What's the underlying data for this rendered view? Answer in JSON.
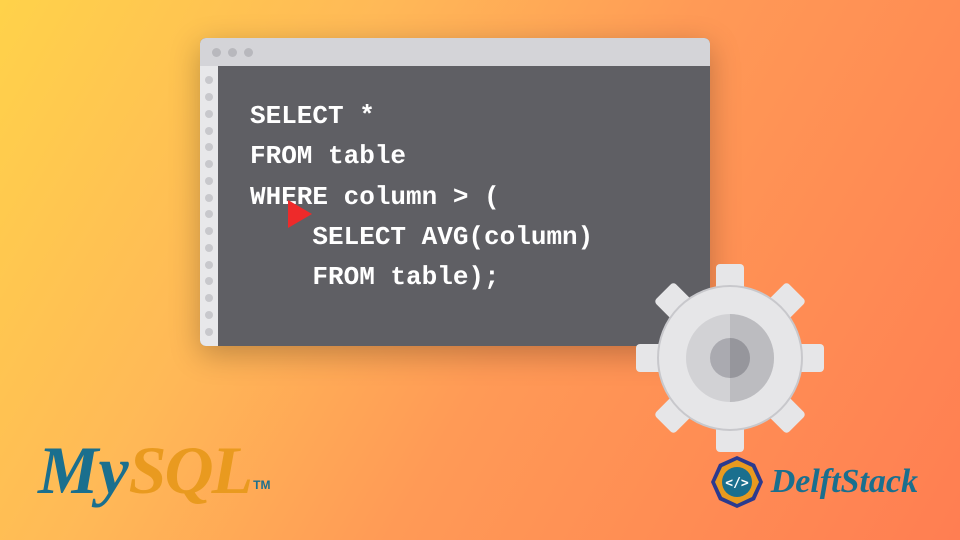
{
  "code": {
    "line1": "SELECT *",
    "line2": "FROM table",
    "line3": "WHERE column > (",
    "line4": "    SELECT AVG(column)",
    "line5": "    FROM table);"
  },
  "logos": {
    "mysql_my": "My",
    "mysql_sql": "SQL",
    "mysql_tm": "TM",
    "delft": "DelftStack"
  },
  "colors": {
    "code_bg": "#5f5f64",
    "triangle": "#ee2a2a",
    "mysql_blue": "#1a6f8e",
    "mysql_orange": "#e99a1f",
    "gear_light": "#e6e6e8",
    "gear_dark": "#b8b8bc"
  }
}
